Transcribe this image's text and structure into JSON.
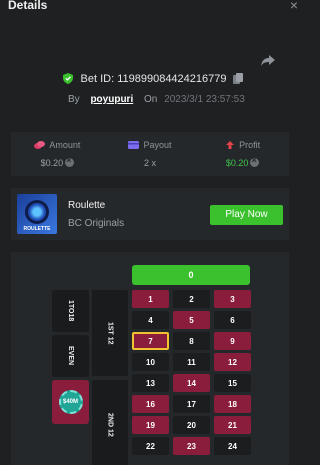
{
  "header": {
    "title": "Details",
    "close_icon": "×"
  },
  "bet": {
    "id_label": "Bet ID:",
    "id_value": "119899084424216779",
    "by_label": "By",
    "username": "poyupuri",
    "on_label": "On",
    "timestamp": "2023/3/1 23:57:53"
  },
  "stats": {
    "amount_label": "Amount",
    "amount_value": "$0.20",
    "payout_label": "Payout",
    "payout_value": "2 x",
    "profit_label": "Profit",
    "profit_value": "$0.20"
  },
  "game": {
    "name": "Roulette",
    "provider": "BC Originals",
    "thumb_label": "ROULETTE",
    "play_label": "Play Now"
  },
  "board": {
    "zero_label": "0",
    "side_labels": [
      "1TO18",
      "EVEN"
    ],
    "dozen_labels": [
      "1ST 12",
      "2ND 12"
    ],
    "chip_label": "$40M",
    "numbers": [
      {
        "n": "1",
        "color": "red"
      },
      {
        "n": "2",
        "color": "black"
      },
      {
        "n": "3",
        "color": "red"
      },
      {
        "n": "4",
        "color": "black"
      },
      {
        "n": "5",
        "color": "red"
      },
      {
        "n": "6",
        "color": "black"
      },
      {
        "n": "7",
        "color": "red",
        "highlight": true
      },
      {
        "n": "8",
        "color": "black"
      },
      {
        "n": "9",
        "color": "red"
      },
      {
        "n": "10",
        "color": "black"
      },
      {
        "n": "11",
        "color": "black"
      },
      {
        "n": "12",
        "color": "red"
      },
      {
        "n": "13",
        "color": "black"
      },
      {
        "n": "14",
        "color": "red"
      },
      {
        "n": "15",
        "color": "black"
      },
      {
        "n": "16",
        "color": "red"
      },
      {
        "n": "17",
        "color": "black"
      },
      {
        "n": "18",
        "color": "red"
      },
      {
        "n": "19",
        "color": "red"
      },
      {
        "n": "20",
        "color": "black"
      },
      {
        "n": "21",
        "color": "red"
      },
      {
        "n": "22",
        "color": "black"
      },
      {
        "n": "23",
        "color": "red"
      },
      {
        "n": "24",
        "color": "black"
      }
    ]
  },
  "colors": {
    "green": "#3bc12d",
    "red": "#8a1d3c",
    "black": "#1b1d1f",
    "highlight": "#f2c230"
  }
}
